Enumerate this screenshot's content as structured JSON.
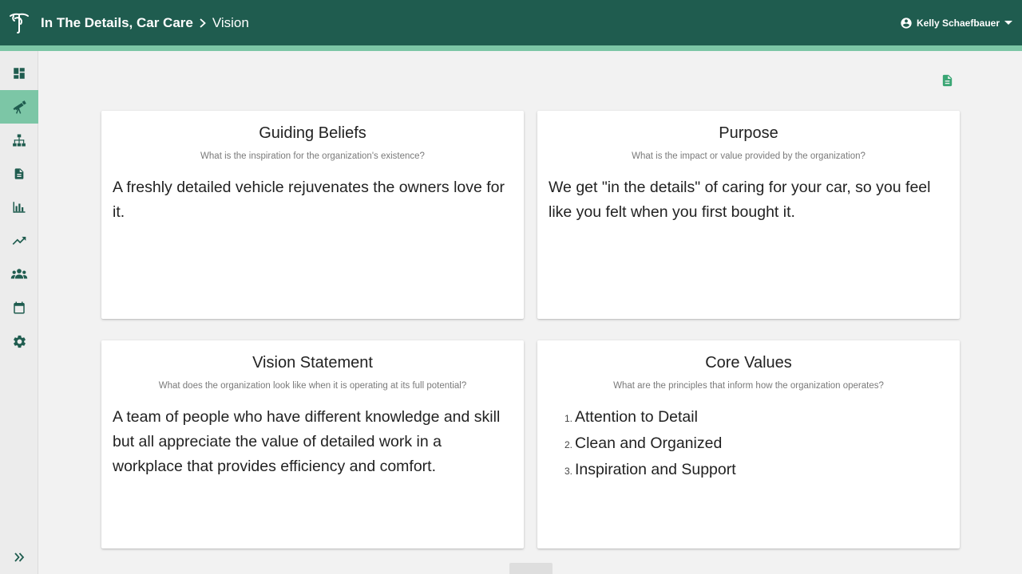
{
  "header": {
    "org_name": "In The Details, Car Care",
    "page_name": "Vision",
    "user_name": "Kelly Schaefbauer"
  },
  "sidebar": {
    "items": [
      {
        "icon": "dashboard-icon",
        "active": false
      },
      {
        "icon": "telescope-icon",
        "active": true
      },
      {
        "icon": "org-chart-icon",
        "active": false
      },
      {
        "icon": "document-icon",
        "active": false
      },
      {
        "icon": "bar-chart-icon",
        "active": false
      },
      {
        "icon": "trending-up-icon",
        "active": false
      },
      {
        "icon": "people-icon",
        "active": false
      },
      {
        "icon": "calendar-icon",
        "active": false
      },
      {
        "icon": "gear-icon",
        "active": false
      }
    ],
    "expand_icon": "double-chevron-right-icon"
  },
  "cards": {
    "guiding_beliefs": {
      "title": "Guiding Beliefs",
      "subtitle": "What is the inspiration for the organization's existence?",
      "body": "A freshly detailed vehicle rejuvenates the owners love for it."
    },
    "purpose": {
      "title": "Purpose",
      "subtitle": "What is the impact or value provided by the organization?",
      "body": "We get \"in the details\" of caring for your car, so you feel like you felt when you first bought it."
    },
    "vision_statement": {
      "title": "Vision Statement",
      "subtitle": "What does the organization look like when it is operating at its full potential?",
      "body": "A team of people who have different knowledge and skill but all appreciate the value of detailed work in a workplace that provides efficiency and comfort."
    },
    "core_values": {
      "title": "Core Values",
      "subtitle": "What are the principles that inform how the organization operates?",
      "items": [
        {
          "num": "1.",
          "text": "Attention to Detail"
        },
        {
          "num": "2.",
          "text": "Clean and Organized"
        },
        {
          "num": "3.",
          "text": "Inspiration and Support"
        }
      ]
    }
  },
  "colors": {
    "header_bg": "#1f5c4f",
    "accent": "#7cc6a6",
    "icon": "#1f5c4f",
    "export_icon": "#3aa674"
  }
}
